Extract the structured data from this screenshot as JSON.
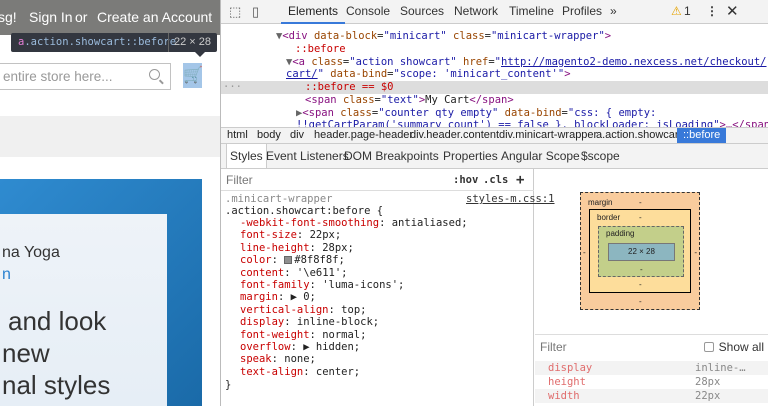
{
  "page": {
    "topbar": {
      "msg_fragment": "sg!",
      "sign_in": "Sign In",
      "or": "or",
      "create_account": "Create an Account"
    },
    "tooltip": {
      "tag": "a",
      "selector": ".action.showcart::before",
      "size": "22 × 28"
    },
    "search_placeholder": "entire store here...",
    "banner": {
      "line1": "na Yoga",
      "line2": "n",
      "big1": "and look",
      "big2": "new",
      "big3": "nal styles"
    }
  },
  "devtools": {
    "tabs": [
      "Elements",
      "Console",
      "Sources",
      "Network",
      "Timeline",
      "Profiles"
    ],
    "active_tab": "Elements",
    "more": "»",
    "warnings": "1",
    "accent": "#3879d9",
    "dom": {
      "l1_tag": "<div",
      "l1_a1": "data-block",
      "l1_v1": "\"minicart\"",
      "l1_a2": "class",
      "l1_v2": "\"minicart-wrapper\"",
      "l1_end": ">",
      "l2": "::before",
      "l3_tag": "<a",
      "l3_a1": "class",
      "l3_v1": "\"action showcart\"",
      "l3_a2": "href",
      "l3_v2": "http://magento2-demo.nexcess.net/checkout/",
      "l4_v2": "cart/",
      "l4_a3": "data-bind",
      "l4_v3": "\"scope: 'minicart_content'\"",
      "l5": "::before == $0",
      "l6_tag": "<span",
      "l6_a": "class",
      "l6_v": "\"text\"",
      "l6_text": "My Cart",
      "l6_close": "</span>",
      "l7_tag": "<span",
      "l7_a1": "class",
      "l7_v1": "\"counter qty empty\"",
      "l7_a2": "data-bind",
      "l7_v2": "\"css: { empty:",
      "l8_v2": "!!getCartParam('summary_count') == false }, blockLoader: isLoading\"",
      "l8_end": ">…</span>"
    },
    "breadcrumbs": [
      "html",
      "body",
      "div",
      "header.page-header",
      "div.header.content",
      "div.minicart-wrapper",
      "a.action.showcart",
      "::before"
    ],
    "subtabs": [
      "Styles",
      "Event Listeners",
      "DOM Breakpoints",
      "Properties",
      "Angular Scope",
      "$scope"
    ],
    "styles": {
      "filter_placeholder": "Filter",
      "hov": ":hov",
      "cls": ".cls",
      "plus": "+",
      "selector1": ".minicart-wrapper",
      "selector2": ".action.showcart:before {",
      "source": "styles-m.css:1",
      "props": [
        {
          "name": "-webkit-font-smoothing",
          "value": "antialiased;"
        },
        {
          "name": "font-size",
          "value": "22px;"
        },
        {
          "name": "line-height",
          "value": "28px;"
        },
        {
          "name": "color",
          "value": "#8f8f8f;"
        },
        {
          "name": "content",
          "value": "'\\e611';"
        },
        {
          "name": "font-family",
          "value": "'luma-icons';"
        },
        {
          "name": "margin",
          "value": "▶ 0;"
        },
        {
          "name": "vertical-align",
          "value": "top;"
        },
        {
          "name": "display",
          "value": "inline-block;"
        },
        {
          "name": "font-weight",
          "value": "normal;"
        },
        {
          "name": "overflow",
          "value": "▶ hidden;"
        },
        {
          "name": "speak",
          "value": "none;"
        },
        {
          "name": "text-align",
          "value": "center;"
        }
      ],
      "close": "}"
    },
    "boxmodel": {
      "margin": "margin",
      "border": "border",
      "padding": "padding",
      "dash": "-",
      "content": "22 × 28"
    },
    "computed": {
      "filter": "Filter",
      "show_all": "Show all",
      "rows": [
        {
          "name": "display",
          "value": "inline-…"
        },
        {
          "name": "height",
          "value": "28px"
        },
        {
          "name": "width",
          "value": "22px"
        }
      ]
    }
  }
}
